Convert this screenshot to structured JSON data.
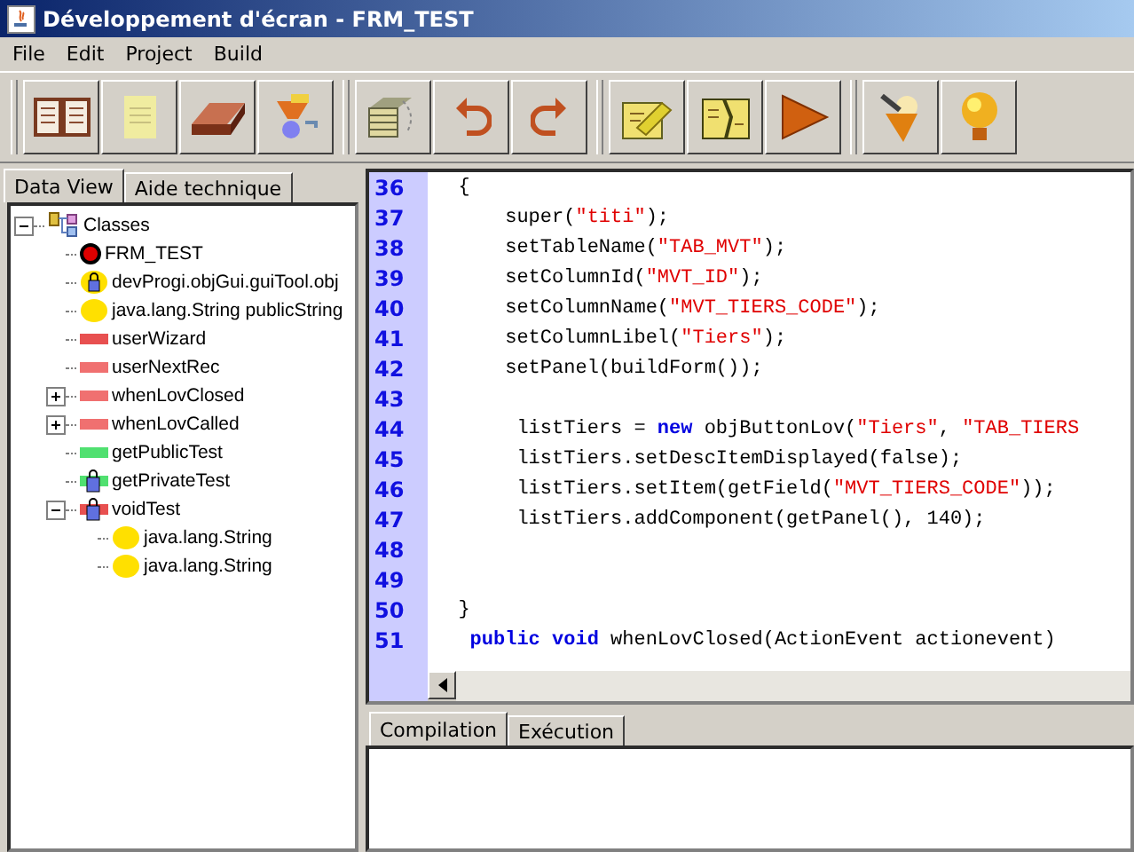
{
  "window": {
    "title": "Développement d'écran - FRM_TEST"
  },
  "menu": [
    "File",
    "Edit",
    "Project",
    "Build"
  ],
  "toolbar_groups": [
    [
      {
        "kind": "book"
      },
      {
        "kind": "note"
      },
      {
        "kind": "brick"
      },
      {
        "kind": "funnel"
      }
    ],
    [
      {
        "kind": "stack"
      },
      {
        "kind": "undo"
      },
      {
        "kind": "redo"
      }
    ],
    [
      {
        "kind": "note-pen"
      },
      {
        "kind": "note-torn"
      },
      {
        "kind": "play"
      }
    ],
    [
      {
        "kind": "wand"
      },
      {
        "kind": "bulb"
      }
    ]
  ],
  "left_tabs": [
    {
      "label": "Data View",
      "selected": true
    },
    {
      "label": "Aide technique",
      "selected": false
    }
  ],
  "tree": [
    {
      "label": "Classes",
      "kind": "class",
      "expanded": true,
      "children": [
        {
          "label": "FRM_TEST",
          "kind": "form"
        },
        {
          "label": "devProgi.objGui.guiTool.obj",
          "kind": "field",
          "locked": true
        },
        {
          "label": "java.lang.String publicString",
          "kind": "field",
          "locked": false
        },
        {
          "label": "userWizard",
          "kind": "method",
          "color": "#e85050",
          "locked": false
        },
        {
          "label": "userNextRec",
          "kind": "method",
          "color": "#f07070",
          "locked": false
        },
        {
          "label": "whenLovClosed",
          "kind": "method",
          "color": "#f07070",
          "locked": false,
          "expanded": false
        },
        {
          "label": "whenLovCalled",
          "kind": "method",
          "color": "#f07070",
          "locked": false,
          "expanded": false
        },
        {
          "label": "getPublicTest",
          "kind": "method",
          "color": "#50e070",
          "locked": false
        },
        {
          "label": "getPrivateTest",
          "kind": "method",
          "color": "#50e070",
          "locked": true
        },
        {
          "label": "voidTest",
          "kind": "method",
          "color": "#e85050",
          "locked": true,
          "expanded": true,
          "children": [
            {
              "label": "java.lang.String",
              "kind": "field",
              "locked": false
            },
            {
              "label": "java.lang.String",
              "kind": "field",
              "locked": false
            }
          ]
        }
      ]
    }
  ],
  "editor": {
    "lines": [
      {
        "number": "36",
        "segments": [
          {
            "kind": "plain",
            "text": "  {"
          }
        ]
      },
      {
        "number": "37",
        "segments": [
          {
            "kind": "plain",
            "text": "      super("
          },
          {
            "kind": "string",
            "text": "\"titi\""
          },
          {
            "kind": "plain",
            "text": ");"
          }
        ]
      },
      {
        "number": "38",
        "segments": [
          {
            "kind": "plain",
            "text": "      setTableName("
          },
          {
            "kind": "string",
            "text": "\"TAB_MVT\""
          },
          {
            "kind": "plain",
            "text": ");"
          }
        ]
      },
      {
        "number": "39",
        "segments": [
          {
            "kind": "plain",
            "text": "      setColumnId("
          },
          {
            "kind": "string",
            "text": "\"MVT_ID\""
          },
          {
            "kind": "plain",
            "text": ");"
          }
        ]
      },
      {
        "number": "40",
        "segments": [
          {
            "kind": "plain",
            "text": "      setColumnName("
          },
          {
            "kind": "string",
            "text": "\"MVT_TIERS_CODE\""
          },
          {
            "kind": "plain",
            "text": ");"
          }
        ]
      },
      {
        "number": "41",
        "segments": [
          {
            "kind": "plain",
            "text": "      setColumnLibel("
          },
          {
            "kind": "string",
            "text": "\"Tiers\""
          },
          {
            "kind": "plain",
            "text": ");"
          }
        ]
      },
      {
        "number": "42",
        "segments": [
          {
            "kind": "plain",
            "text": "      setPanel(buildForm());"
          }
        ]
      },
      {
        "number": "43"
      },
      {
        "number": "44",
        "segments": [
          {
            "kind": "plain",
            "text": "       listTiers = "
          },
          {
            "kind": "keyword",
            "text": "new"
          },
          {
            "kind": "plain",
            "text": " objButtonLov("
          },
          {
            "kind": "string",
            "text": "\"Tiers\""
          },
          {
            "kind": "plain",
            "text": ", "
          },
          {
            "kind": "string",
            "text": "\"TAB_TIERS"
          }
        ]
      },
      {
        "number": "45",
        "segments": [
          {
            "kind": "plain",
            "text": "       listTiers.setDescItemDisplayed(false);"
          }
        ]
      },
      {
        "number": "46",
        "segments": [
          {
            "kind": "plain",
            "text": "       listTiers.setItem(getField("
          },
          {
            "kind": "string",
            "text": "\"MVT_TIERS_CODE\""
          },
          {
            "kind": "plain",
            "text": "));"
          }
        ]
      },
      {
        "number": "47",
        "segments": [
          {
            "kind": "plain",
            "text": "       listTiers.addComponent(getPanel(), 140);"
          }
        ]
      },
      {
        "number": "48"
      },
      {
        "number": "49"
      },
      {
        "number": "50",
        "segments": [
          {
            "kind": "plain",
            "text": "  }"
          }
        ]
      },
      {
        "number": "51",
        "segments": [
          {
            "kind": "keyword",
            "text": "   public void"
          },
          {
            "kind": "plain",
            "text": " whenLovClosed(ActionEvent actionevent)"
          }
        ]
      }
    ]
  },
  "bottom_tabs": [
    {
      "label": "Compilation",
      "selected": true
    },
    {
      "label": "Exécution",
      "selected": false
    }
  ]
}
